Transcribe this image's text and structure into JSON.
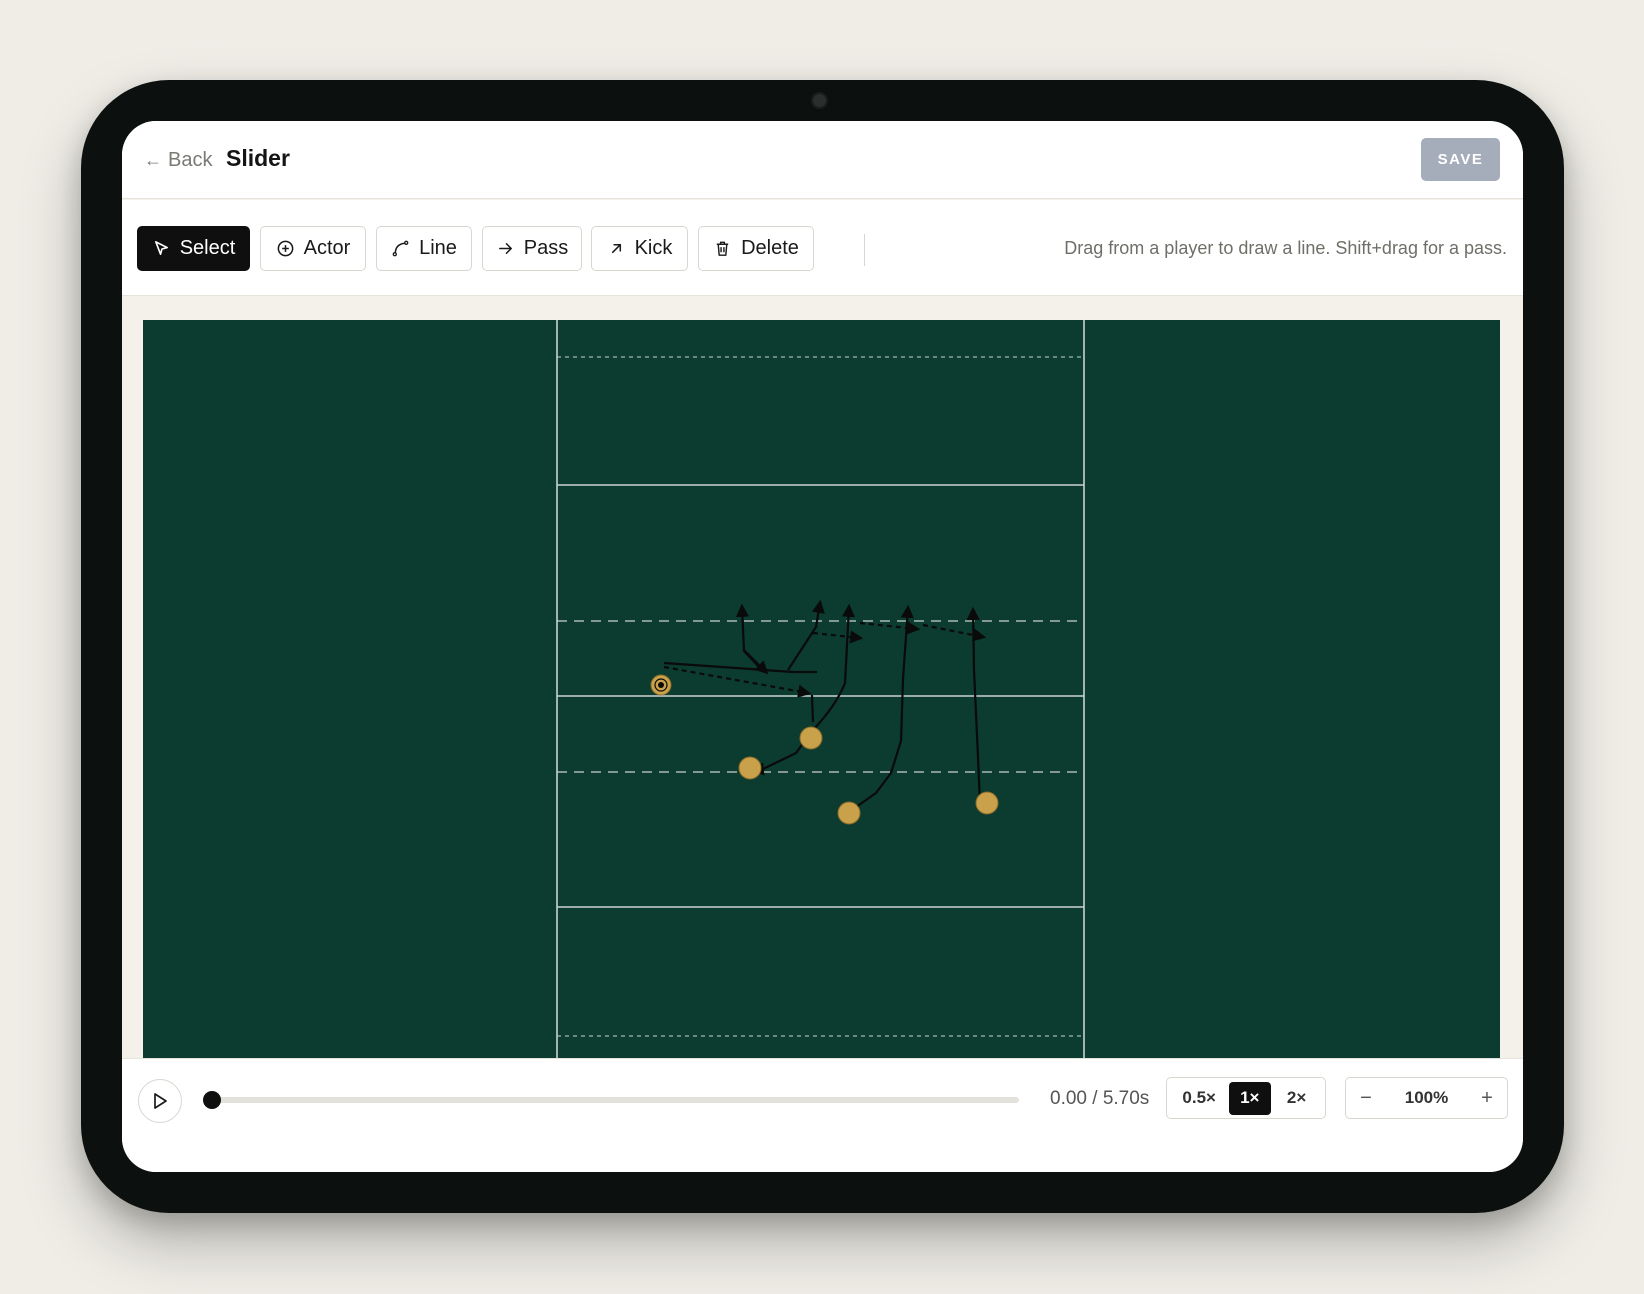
{
  "header": {
    "back_label": "Back",
    "title": "Slider",
    "save_label": "SAVE"
  },
  "toolbar": {
    "tools": [
      {
        "label": "Select",
        "icon": "cursor-icon",
        "active": true
      },
      {
        "label": "Actor",
        "icon": "plus-circle-icon",
        "active": false
      },
      {
        "label": "Line",
        "icon": "curve-icon",
        "active": false
      },
      {
        "label": "Pass",
        "icon": "arrow-right-icon",
        "active": false
      },
      {
        "label": "Kick",
        "icon": "arrow-up-right-icon",
        "active": false
      },
      {
        "label": "Delete",
        "icon": "trash-icon",
        "active": false
      }
    ],
    "hint": "Drag from a player to draw a line. Shift+drag for a pass."
  },
  "field": {
    "colors": {
      "field": "#0c3c2f",
      "lines": "#c9d3cf",
      "player": "#c9a14b",
      "route": "#0a0a0a"
    }
  },
  "playback": {
    "progress": 0,
    "time": "0.00 / 5.70s",
    "speeds": [
      "0.5×",
      "1×",
      "2×"
    ],
    "active_speed": "1×",
    "zoom": "100%",
    "zoom_out": "−",
    "zoom_in": "+"
  }
}
